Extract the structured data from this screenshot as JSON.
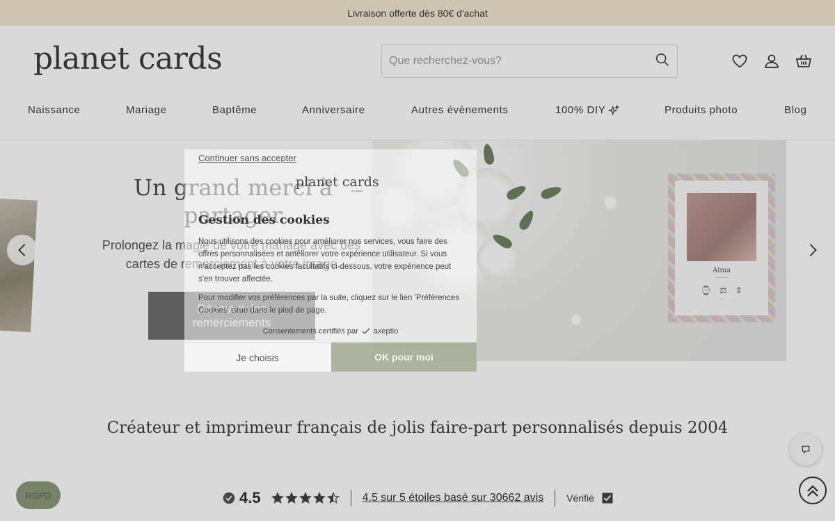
{
  "promo": {
    "text": "Livraison offerte dès 80€ d'achat"
  },
  "header": {
    "logo": "planet cards",
    "search_placeholder": "Que recherchez-vous?",
    "icons": [
      "search-icon",
      "heart-icon",
      "user-icon",
      "basket-icon"
    ]
  },
  "nav": {
    "items": [
      {
        "label": "Naissance"
      },
      {
        "label": "Mariage"
      },
      {
        "label": "Baptême"
      },
      {
        "label": "Anniversaire"
      },
      {
        "label": "Autres évènements"
      },
      {
        "label": "100% DIY"
      },
      {
        "label": "Produits photo"
      },
      {
        "label": "Blog"
      }
    ]
  },
  "hero": {
    "title": "Un grand merci à partager",
    "subtitle": "Prolongez la magie de votre mariage avec des cartes de remerciement à votre image",
    "button": "Découvrir les remerciements",
    "card": {
      "name": "Alma"
    }
  },
  "tagline": "Créateur et imprimeur français de jolis faire-part personnalisés depuis 2004",
  "rating": {
    "score": "4.5",
    "stars_value": 4.5,
    "stars_max": 5,
    "summary": "4.5 sur 5 étoiles basé sur 30662 avis",
    "verified": "Vérifié"
  },
  "floating": {
    "rgpd": "RGPD"
  },
  "cookie_modal": {
    "skip": "Continuer sans accepter",
    "logo": "planet cards",
    "logo_sub": "by apepe",
    "title": "Gestion des cookies",
    "text1": "Nous utilisons des cookies pour améliorer nos services, vous faire des offres personnalisées et améliorer votre expérience utilisateur. Si vous n'acceptez pas les cookies facultatifs ci-dessous, votre expérience peut s'en trouver affectée.",
    "text2": "Pour modifier vos préférences par la suite, cliquez sur le lien 'Préférences Cookies' situé dans le pied de page.",
    "certified": "Consentements certifiés par",
    "certifier": "axeptio",
    "choose_button": "Je choisis",
    "ok_button": "OK pour moi"
  },
  "colors": {
    "promo_bg": "#f3e9cf",
    "button_dark": "#6b6f6b",
    "accent_green": "#96a082",
    "rgpd_bg": "#8c9a7a"
  }
}
